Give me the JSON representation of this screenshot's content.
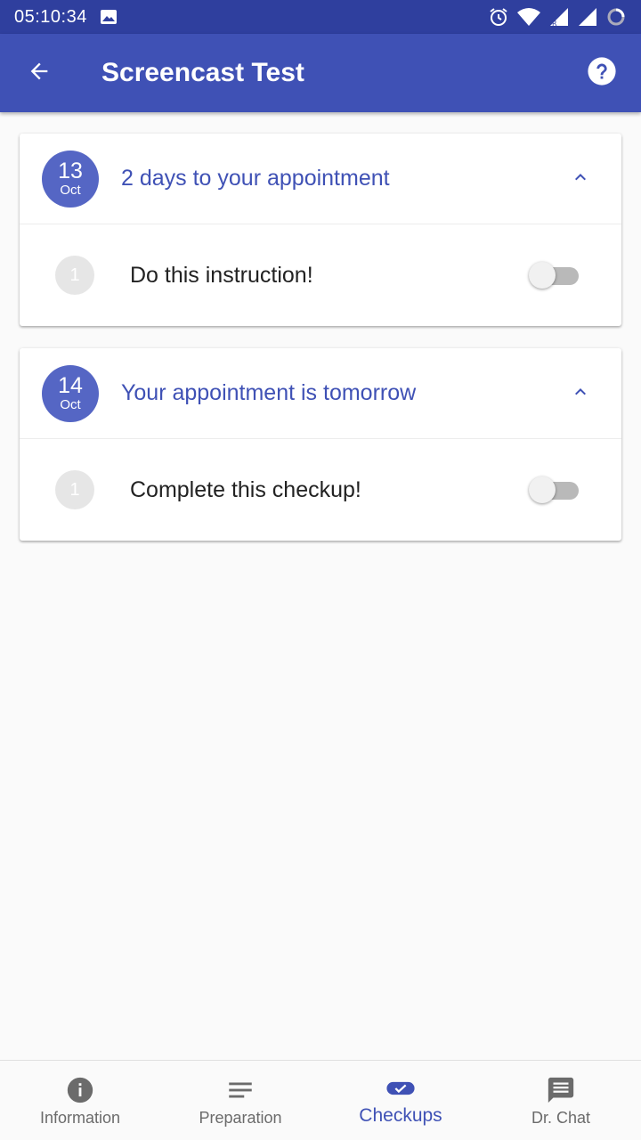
{
  "status_bar": {
    "time": "05:10:34",
    "icons": [
      "image-icon",
      "alarm-icon",
      "wifi-icon",
      "signal-r-icon",
      "signal-icon",
      "loading-icon"
    ]
  },
  "app_bar": {
    "title": "Screencast Test",
    "back_icon": "arrow-back-icon",
    "help_icon": "help-icon"
  },
  "cards": [
    {
      "day": "13",
      "month": "Oct",
      "title": "2 days to your appointment",
      "expanded": true,
      "items": [
        {
          "number": "1",
          "text": "Do this instruction!",
          "checked": false
        }
      ]
    },
    {
      "day": "14",
      "month": "Oct",
      "title": "Your appointment is tomorrow",
      "expanded": true,
      "items": [
        {
          "number": "1",
          "text": "Complete this checkup!",
          "checked": false
        }
      ]
    }
  ],
  "bottom_nav": {
    "items": [
      {
        "label": "Information",
        "icon": "info-icon"
      },
      {
        "label": "Preparation",
        "icon": "notes-icon"
      },
      {
        "label": "Checkups",
        "icon": "checkup-icon",
        "active": true
      },
      {
        "label": "Dr. Chat",
        "icon": "chat-icon"
      }
    ]
  },
  "colors": {
    "status_bar": "#2f3f9e",
    "primary": "#3f51b5",
    "date_badge": "#5566c4",
    "background": "#fafafa"
  }
}
